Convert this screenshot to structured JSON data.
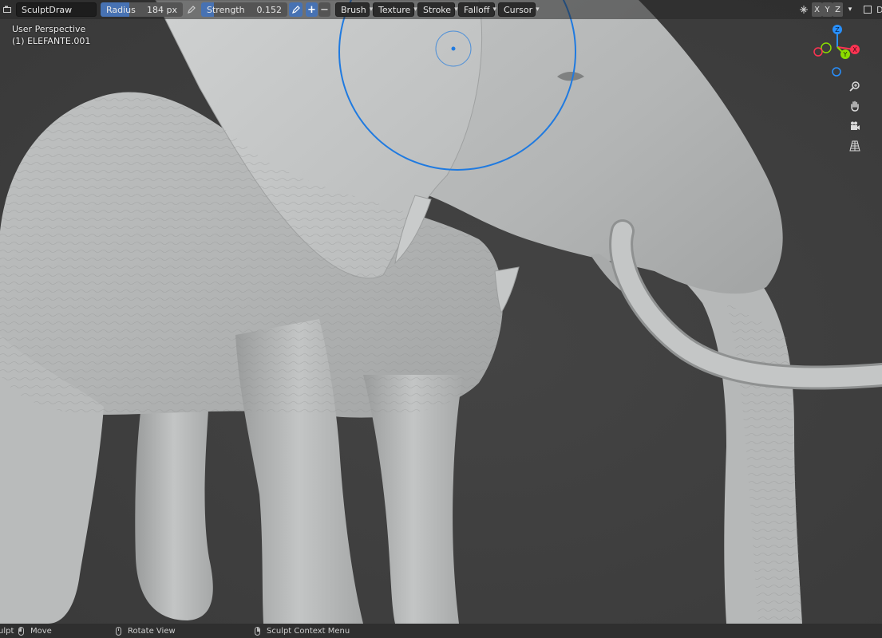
{
  "header": {
    "editor_type_icon": "viewport-editor-icon",
    "brush_name": "SculptDraw",
    "radius": {
      "label": "Radius",
      "value": "184 px",
      "fill": 0.35
    },
    "strength": {
      "label": "Strength",
      "value": "0.152",
      "fill": 0.152
    },
    "plus_label": "+",
    "minus_label": "−",
    "menus": [
      "Brush",
      "Texture",
      "Stroke",
      "Falloff",
      "Cursor"
    ],
    "symmetry_axes": [
      "X",
      "Y",
      "Z"
    ],
    "cut_label": "D"
  },
  "overlay": {
    "view_name": "User Perspective",
    "object_name": "(1) ELEFANTE.001"
  },
  "gizmo": {
    "z_label": "Z",
    "y_label": "Y",
    "x_label": "X"
  },
  "statusbar": {
    "cut_label": "ulpt",
    "move": "Move",
    "rotate_view": "Rotate View",
    "context_menu": "Sculpt Context Menu"
  },
  "colors": {
    "accent": "#4772b3",
    "brush_cursor": "#1f7ae0",
    "background": "#3d3d3d",
    "axis_x": "#ff3352",
    "axis_y": "#8bdc00",
    "axis_z": "#2890ff"
  }
}
